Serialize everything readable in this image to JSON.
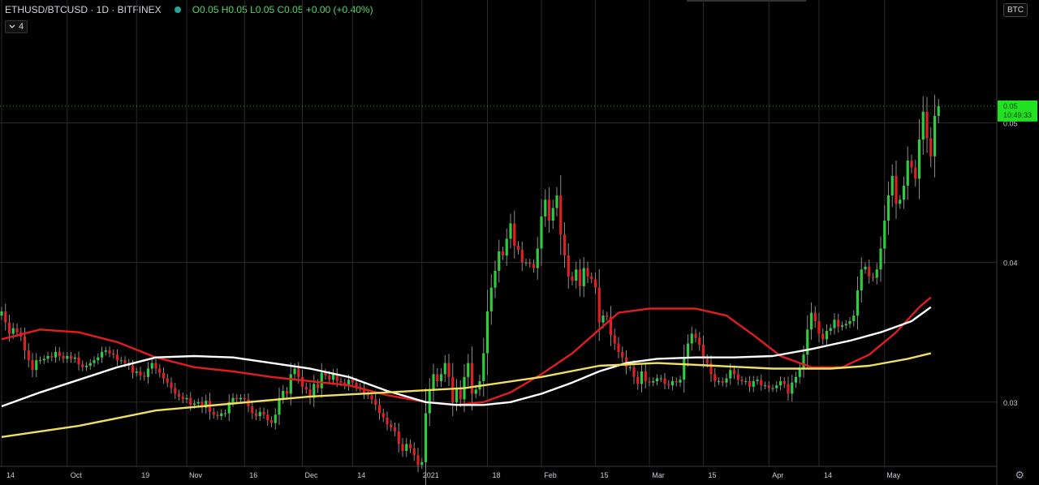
{
  "header": {
    "symbol": "ETHUSD/BTCUSD · 1D · BITFINEX",
    "ohlc": {
      "o": "O0.05",
      "h": "H0.05",
      "l": "L0.05",
      "c": "C0.05",
      "change": "+0.00 (+0.40%)"
    },
    "indicators_count": "4",
    "chevron_icon": "chevron-down-icon"
  },
  "currency_button": "BTC",
  "settings_icon": "gear-icon",
  "price_label": {
    "price": "0.05",
    "countdown": "10:49:33"
  },
  "colors": {
    "up": "#2ecc40",
    "down": "#e02020",
    "grid": "#2a2a2a",
    "axis_text": "#c8ccd4",
    "ma_red": "#e01e1e",
    "ma_white": "#ffffff",
    "ma_yellow": "#f0e060",
    "price_tag": "#22e022"
  },
  "chart_data": {
    "type": "candlestick",
    "ylim": [
      0.0254,
      0.0588
    ],
    "y_ticks": [
      0.03,
      0.04,
      0.05
    ],
    "y_tick_labels": [
      "0.03",
      "0.04",
      "0.05"
    ],
    "x_ticks": [
      {
        "label": "14",
        "i": 0
      },
      {
        "label": "Oct",
        "i": 17
      },
      {
        "label": "19",
        "i": 35
      },
      {
        "label": "Nov",
        "i": 48
      },
      {
        "label": "16",
        "i": 63
      },
      {
        "label": "Dec",
        "i": 78
      },
      {
        "label": "14",
        "i": 91
      },
      {
        "label": "2021",
        "i": 109
      },
      {
        "label": "18",
        "i": 126
      },
      {
        "label": "Feb",
        "i": 140
      },
      {
        "label": "15",
        "i": 154
      },
      {
        "label": "Mar",
        "i": 168
      },
      {
        "label": "15",
        "i": 182
      },
      {
        "label": "Apr",
        "i": 199
      },
      {
        "label": "14",
        "i": 212
      },
      {
        "label": "May",
        "i": 229
      }
    ],
    "last_price": 0.0512,
    "close": [
      0.0365,
      0.0357,
      0.0349,
      0.0353,
      0.035,
      0.0347,
      0.0337,
      0.033,
      0.0323,
      0.033,
      0.033,
      0.0331,
      0.0333,
      0.0332,
      0.0336,
      0.0333,
      0.0331,
      0.0333,
      0.0331,
      0.0332,
      0.0327,
      0.0325,
      0.0326,
      0.0328,
      0.033,
      0.0332,
      0.0336,
      0.0337,
      0.0335,
      0.0334,
      0.033,
      0.033,
      0.0328,
      0.0326,
      0.0321,
      0.0322,
      0.0319,
      0.0318,
      0.0324,
      0.0328,
      0.0324,
      0.0321,
      0.0317,
      0.0314,
      0.031,
      0.0306,
      0.0304,
      0.0302,
      0.0303,
      0.0298,
      0.0299,
      0.03,
      0.0296,
      0.0301,
      0.0293,
      0.0291,
      0.029,
      0.0292,
      0.0292,
      0.03,
      0.0303,
      0.0302,
      0.0303,
      0.0302,
      0.0297,
      0.0292,
      0.029,
      0.0293,
      0.0291,
      0.0287,
      0.0285,
      0.0291,
      0.0303,
      0.0308,
      0.0306,
      0.032,
      0.0324,
      0.0318,
      0.0311,
      0.0309,
      0.0303,
      0.0313,
      0.031,
      0.0321,
      0.0319,
      0.0316,
      0.032,
      0.0315,
      0.0314,
      0.0312,
      0.0316,
      0.0314,
      0.0311,
      0.031,
      0.0306,
      0.0305,
      0.0302,
      0.0298,
      0.0292,
      0.0289,
      0.0284,
      0.0282,
      0.0279,
      0.027,
      0.0265,
      0.027,
      0.0267,
      0.0262,
      0.0255,
      0.0257,
      0.0292,
      0.0308,
      0.032,
      0.0315,
      0.032,
      0.0328,
      0.0318,
      0.03,
      0.031,
      0.0302,
      0.0318,
      0.0328,
      0.0306,
      0.0309,
      0.0315,
      0.0335,
      0.0365,
      0.0382,
      0.0394,
      0.0408,
      0.0405,
      0.0417,
      0.0428,
      0.0412,
      0.0409,
      0.04,
      0.04,
      0.0399,
      0.0396,
      0.041,
      0.0433,
      0.0445,
      0.043,
      0.0439,
      0.0448,
      0.042,
      0.0405,
      0.039,
      0.0387,
      0.0395,
      0.0383,
      0.0396,
      0.039,
      0.0388,
      0.0382,
      0.0357,
      0.0362,
      0.0361,
      0.0348,
      0.0342,
      0.0336,
      0.0332,
      0.0325,
      0.0325,
      0.0318,
      0.0313,
      0.0322,
      0.0315,
      0.0314,
      0.0315,
      0.0317,
      0.0317,
      0.0313,
      0.0312,
      0.0315,
      0.0314,
      0.0316,
      0.0332,
      0.0342,
      0.0349,
      0.0346,
      0.0341,
      0.0331,
      0.0328,
      0.032,
      0.0315,
      0.0315,
      0.0314,
      0.0317,
      0.0323,
      0.032,
      0.0316,
      0.0315,
      0.0315,
      0.0311,
      0.0315,
      0.0316,
      0.0312,
      0.0312,
      0.031,
      0.031,
      0.0312,
      0.0315,
      0.0313,
      0.0306,
      0.0314,
      0.0318,
      0.0324,
      0.0334,
      0.0352,
      0.0364,
      0.0358,
      0.0349,
      0.0345,
      0.0351,
      0.0353,
      0.0359,
      0.0354,
      0.0355,
      0.0356,
      0.0358,
      0.0362,
      0.038,
      0.0395,
      0.0397,
      0.039,
      0.0389,
      0.0395,
      0.041,
      0.043,
      0.0448,
      0.0462,
      0.0442,
      0.0445,
      0.0455,
      0.0473,
      0.0468,
      0.046,
      0.0488,
      0.0508,
      0.0489,
      0.0476,
      0.0505,
      0.0512
    ],
    "series": [
      {
        "points": [
          [
            0,
            0.0345
          ],
          [
            10,
            0.0352
          ],
          [
            20,
            0.035
          ],
          [
            30,
            0.0343
          ],
          [
            40,
            0.0332
          ],
          [
            50,
            0.0325
          ],
          [
            60,
            0.0322
          ],
          [
            70,
            0.0318
          ],
          [
            80,
            0.0315
          ],
          [
            90,
            0.0312
          ],
          [
            100,
            0.0305
          ],
          [
            110,
            0.03
          ],
          [
            118,
            0.0298
          ],
          [
            125,
            0.03
          ],
          [
            132,
            0.0307
          ],
          [
            140,
            0.032
          ],
          [
            148,
            0.0335
          ],
          [
            155,
            0.0352
          ],
          [
            160,
            0.0364
          ],
          [
            168,
            0.0367
          ],
          [
            180,
            0.0367
          ],
          [
            188,
            0.0362
          ],
          [
            195,
            0.0348
          ],
          [
            202,
            0.0333
          ],
          [
            210,
            0.0325
          ],
          [
            218,
            0.0325
          ],
          [
            225,
            0.0334
          ],
          [
            232,
            0.035
          ],
          [
            238,
            0.0368
          ],
          [
            241,
            0.0375
          ]
        ]
      },
      {
        "points": [
          [
            0,
            0.0297
          ],
          [
            10,
            0.0307
          ],
          [
            20,
            0.0316
          ],
          [
            30,
            0.0325
          ],
          [
            40,
            0.0332
          ],
          [
            50,
            0.0333
          ],
          [
            60,
            0.0332
          ],
          [
            70,
            0.0328
          ],
          [
            80,
            0.0324
          ],
          [
            90,
            0.0318
          ],
          [
            100,
            0.0308
          ],
          [
            110,
            0.03
          ],
          [
            118,
            0.0298
          ],
          [
            125,
            0.0298
          ],
          [
            132,
            0.03
          ],
          [
            140,
            0.0306
          ],
          [
            148,
            0.0314
          ],
          [
            155,
            0.0322
          ],
          [
            162,
            0.0328
          ],
          [
            170,
            0.0331
          ],
          [
            180,
            0.0332
          ],
          [
            190,
            0.0332
          ],
          [
            200,
            0.0333
          ],
          [
            210,
            0.0338
          ],
          [
            220,
            0.0344
          ],
          [
            228,
            0.035
          ],
          [
            236,
            0.0358
          ],
          [
            241,
            0.0368
          ]
        ]
      },
      {
        "points": [
          [
            0,
            0.0275
          ],
          [
            20,
            0.0283
          ],
          [
            40,
            0.0294
          ],
          [
            60,
            0.0299
          ],
          [
            80,
            0.0304
          ],
          [
            100,
            0.0307
          ],
          [
            120,
            0.031
          ],
          [
            140,
            0.0318
          ],
          [
            155,
            0.0326
          ],
          [
            170,
            0.0328
          ],
          [
            185,
            0.0326
          ],
          [
            200,
            0.0324
          ],
          [
            215,
            0.0324
          ],
          [
            225,
            0.0326
          ],
          [
            235,
            0.0331
          ],
          [
            241,
            0.0335
          ]
        ]
      }
    ]
  }
}
